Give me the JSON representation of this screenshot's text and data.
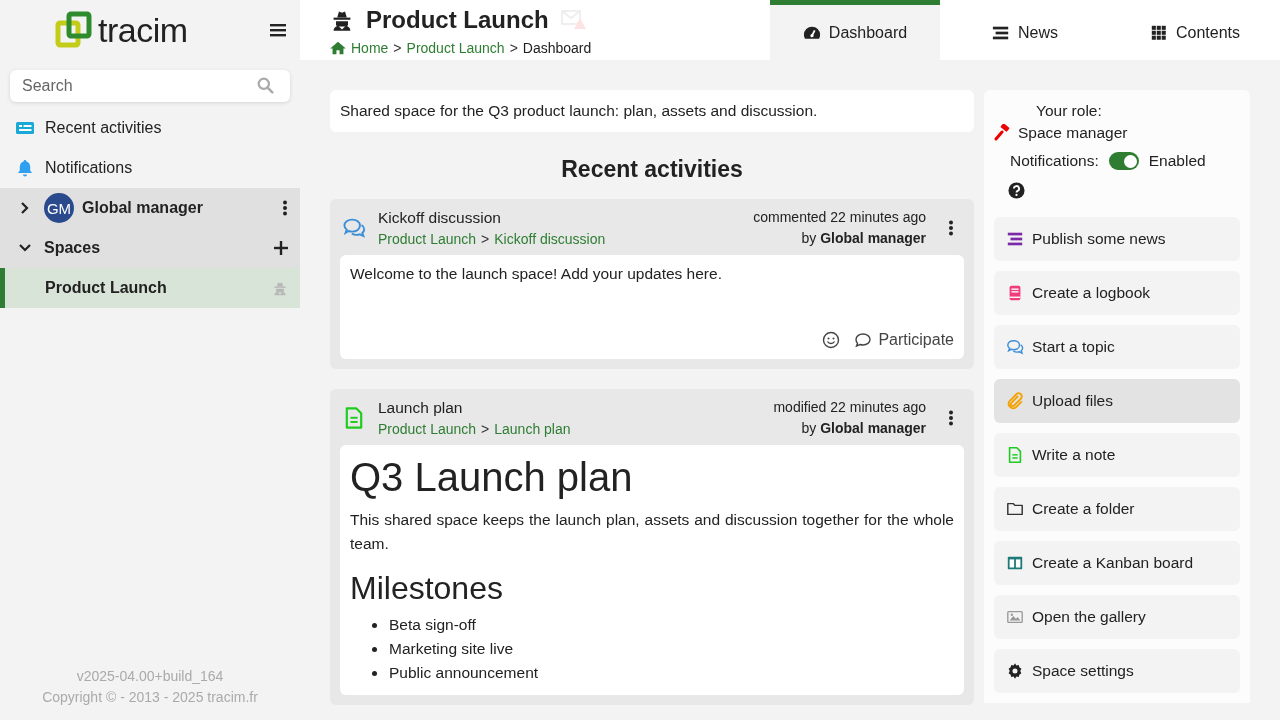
{
  "sidebar": {
    "logo": "tracim",
    "search": {
      "placeholder": "Search"
    },
    "nav": [
      {
        "kind": "activities",
        "label": "Recent activities"
      },
      {
        "kind": "notifications",
        "label": "Notifications"
      }
    ],
    "tree": [
      {
        "kind": "user",
        "avatar": "GM",
        "label": "Global manager",
        "expanded": false
      },
      {
        "kind": "spaces",
        "label": "Spaces",
        "expanded": true,
        "children": [
          {
            "label": "Product Launch",
            "selected": true
          }
        ]
      }
    ],
    "version": "v2025-04.00+build_164",
    "copyright": "Copyright © - 2013 - 2025 tracim.fr"
  },
  "header": {
    "title": "Product Launch",
    "separator": ">",
    "breadcrumb": [
      {
        "label": "Home",
        "link": true
      },
      {
        "label": "Product Launch",
        "link": true
      },
      {
        "label": "Dashboard",
        "link": false
      }
    ],
    "tabs": [
      {
        "kind": "dashboard",
        "label": "Dashboard",
        "selected": true
      },
      {
        "kind": "news",
        "label": "News",
        "selected": false
      },
      {
        "kind": "contents",
        "label": "Contents",
        "selected": false
      }
    ]
  },
  "description": "Shared space for the Q3 product launch: plan, assets and discussion.",
  "activities": {
    "title": "Recent activities",
    "items": [
      {
        "kind": "thread",
        "title": "Kickoff discussion",
        "path": [
          "Product Launch",
          ">",
          "Kickoff discussion"
        ],
        "action": "commented 22 minutes ago",
        "by": "by **Global manager**",
        "body": {
          "text": "Welcome to the launch space! Add your updates here.",
          "participate": "Participate"
        }
      },
      {
        "kind": "note",
        "title": "Launch plan",
        "path": [
          "Product Launch",
          ">",
          "Launch plan"
        ],
        "action": "modified 22 minutes ago",
        "by": "by **Global manager**",
        "body": {
          "heading": "Q3 Launch plan",
          "paragraph": "This shared space keeps the launch plan, assets and discussion together for the whole team.",
          "subheading": "Milestones",
          "bullets": [
            "Beta sign-off",
            "Marketing site live",
            "Public announcement"
          ]
        }
      }
    ]
  },
  "panel": {
    "role_label": "Your role:",
    "role": "Space manager",
    "notifications_label": "Notifications:",
    "notifications": {
      "on": true,
      "label": "Enabled"
    },
    "actions": [
      {
        "kind": "news",
        "label": "Publish some news",
        "hovered": false
      },
      {
        "kind": "logbook",
        "label": "Create a logbook",
        "hovered": false
      },
      {
        "kind": "thread",
        "label": "Start a topic",
        "hovered": false
      },
      {
        "kind": "file",
        "label": "Upload files",
        "hovered": true
      },
      {
        "kind": "note",
        "label": "Write a note",
        "hovered": false
      },
      {
        "kind": "folder",
        "label": "Create a folder",
        "hovered": false
      },
      {
        "kind": "kanban",
        "label": "Create a Kanban board",
        "hovered": false
      },
      {
        "kind": "gallery",
        "label": "Open the gallery",
        "hovered": false
      },
      {
        "kind": "settings",
        "label": "Space settings",
        "hovered": false
      }
    ]
  }
}
